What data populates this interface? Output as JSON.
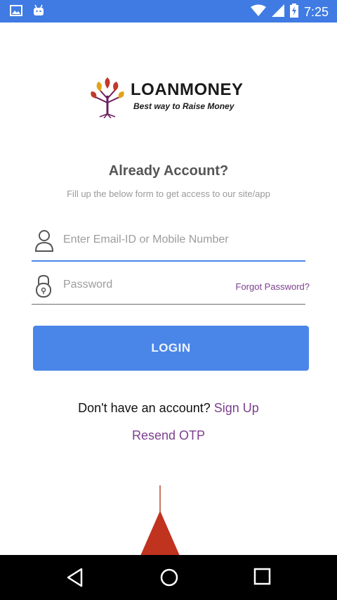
{
  "status_bar": {
    "time": "7:25",
    "icons": [
      "image-icon",
      "android-icon",
      "wifi-icon",
      "signal-icon",
      "battery-charging-icon"
    ]
  },
  "logo": {
    "title": "LOANMONEY",
    "tagline": "Best way to Raise Money",
    "colors": {
      "leaf": "#c0392b",
      "leaf_gold": "#e3a21a",
      "trunk": "#6b1d5e"
    }
  },
  "form": {
    "heading": "Already Account?",
    "subheading": "Fill up the below form to get access to our site/app",
    "email_placeholder": "Enter Email-ID or Mobile Number",
    "password_placeholder": "Password",
    "forgot_label": "Forgot Password?",
    "login_label": "LOGIN"
  },
  "footer": {
    "no_account_text": "Don't have an account?",
    "signup_label": "Sign Up",
    "resend_label": "Resend OTP"
  },
  "colors": {
    "accent": "#4a86e8",
    "link": "#7b3f8e",
    "status_bar": "#3f7be3"
  },
  "nav": {
    "icons": [
      "back-icon",
      "home-icon",
      "recents-icon"
    ]
  }
}
